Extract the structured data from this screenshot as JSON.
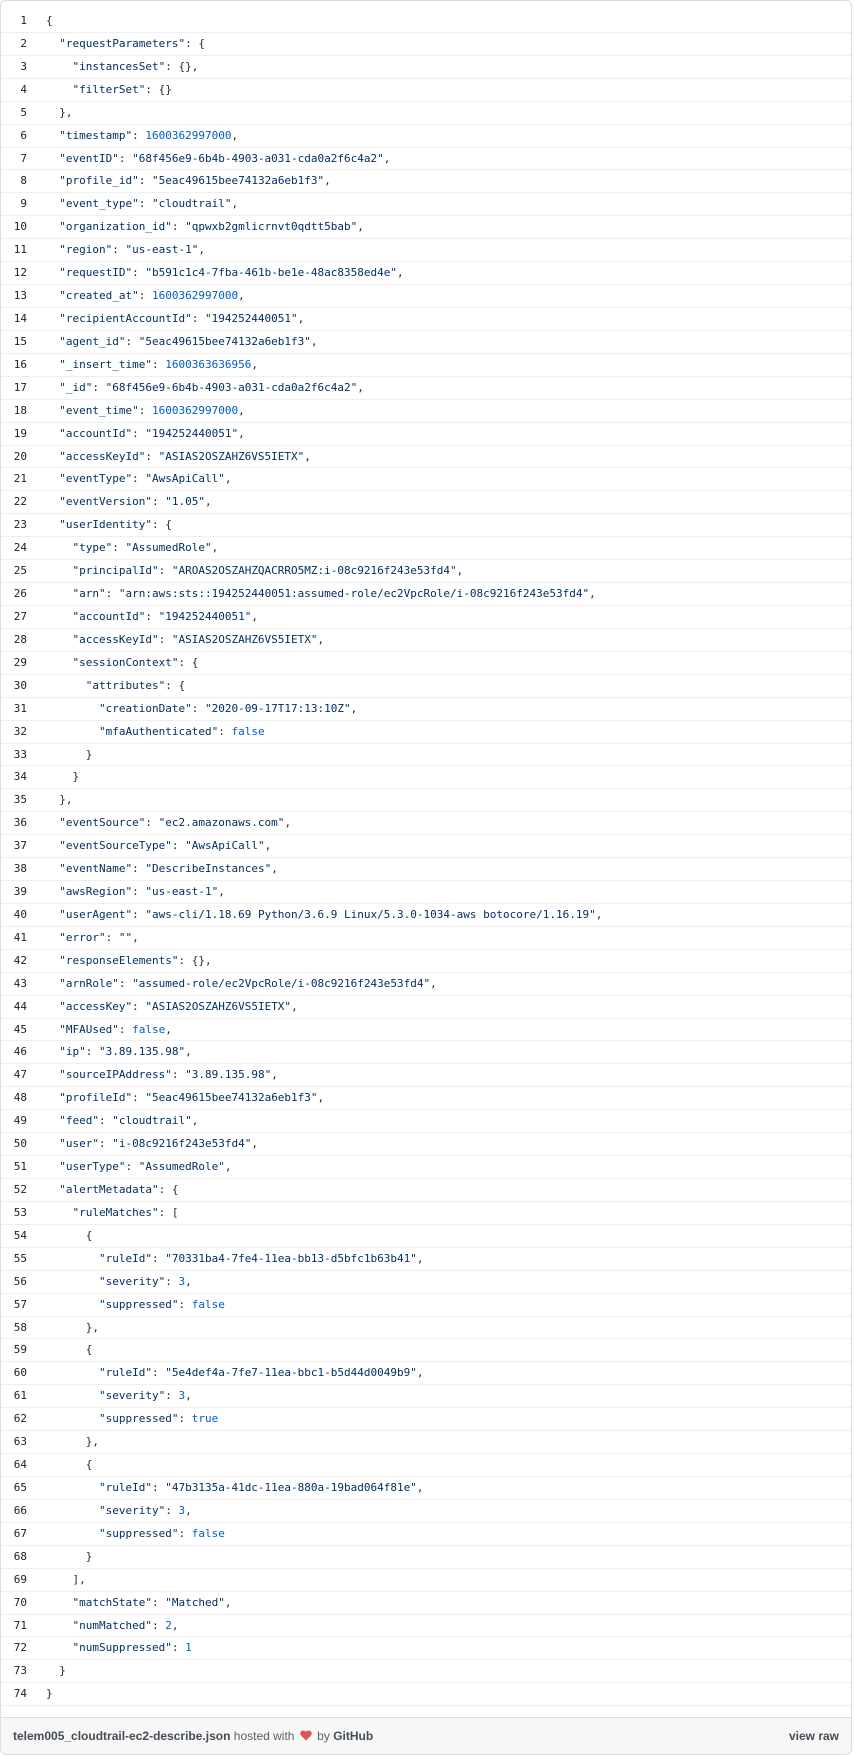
{
  "lines": [
    [
      {
        "t": "p",
        "v": "{"
      }
    ],
    [
      {
        "t": "p",
        "v": "  "
      },
      {
        "t": "k",
        "v": "\"requestParameters\""
      },
      {
        "t": "p",
        "v": ": {"
      }
    ],
    [
      {
        "t": "p",
        "v": "    "
      },
      {
        "t": "k",
        "v": "\"instancesSet\""
      },
      {
        "t": "p",
        "v": ": {},"
      }
    ],
    [
      {
        "t": "p",
        "v": "    "
      },
      {
        "t": "k",
        "v": "\"filterSet\""
      },
      {
        "t": "p",
        "v": ": {}"
      }
    ],
    [
      {
        "t": "p",
        "v": "  },"
      }
    ],
    [
      {
        "t": "p",
        "v": "  "
      },
      {
        "t": "k",
        "v": "\"timestamp\""
      },
      {
        "t": "p",
        "v": ": "
      },
      {
        "t": "n",
        "v": "1600362997000"
      },
      {
        "t": "p",
        "v": ","
      }
    ],
    [
      {
        "t": "p",
        "v": "  "
      },
      {
        "t": "k",
        "v": "\"eventID\""
      },
      {
        "t": "p",
        "v": ": "
      },
      {
        "t": "s",
        "v": "\"68f456e9-6b4b-4903-a031-cda0a2f6c4a2\""
      },
      {
        "t": "p",
        "v": ","
      }
    ],
    [
      {
        "t": "p",
        "v": "  "
      },
      {
        "t": "k",
        "v": "\"profile_id\""
      },
      {
        "t": "p",
        "v": ": "
      },
      {
        "t": "s",
        "v": "\"5eac49615bee74132a6eb1f3\""
      },
      {
        "t": "p",
        "v": ","
      }
    ],
    [
      {
        "t": "p",
        "v": "  "
      },
      {
        "t": "k",
        "v": "\"event_type\""
      },
      {
        "t": "p",
        "v": ": "
      },
      {
        "t": "s",
        "v": "\"cloudtrail\""
      },
      {
        "t": "p",
        "v": ","
      }
    ],
    [
      {
        "t": "p",
        "v": "  "
      },
      {
        "t": "k",
        "v": "\"organization_id\""
      },
      {
        "t": "p",
        "v": ": "
      },
      {
        "t": "s",
        "v": "\"qpwxb2gmlicrnvt0qdtt5bab\""
      },
      {
        "t": "p",
        "v": ","
      }
    ],
    [
      {
        "t": "p",
        "v": "  "
      },
      {
        "t": "k",
        "v": "\"region\""
      },
      {
        "t": "p",
        "v": ": "
      },
      {
        "t": "s",
        "v": "\"us-east-1\""
      },
      {
        "t": "p",
        "v": ","
      }
    ],
    [
      {
        "t": "p",
        "v": "  "
      },
      {
        "t": "k",
        "v": "\"requestID\""
      },
      {
        "t": "p",
        "v": ": "
      },
      {
        "t": "s",
        "v": "\"b591c1c4-7fba-461b-be1e-48ac8358ed4e\""
      },
      {
        "t": "p",
        "v": ","
      }
    ],
    [
      {
        "t": "p",
        "v": "  "
      },
      {
        "t": "k",
        "v": "\"created_at\""
      },
      {
        "t": "p",
        "v": ": "
      },
      {
        "t": "n",
        "v": "1600362997000"
      },
      {
        "t": "p",
        "v": ","
      }
    ],
    [
      {
        "t": "p",
        "v": "  "
      },
      {
        "t": "k",
        "v": "\"recipientAccountId\""
      },
      {
        "t": "p",
        "v": ": "
      },
      {
        "t": "s",
        "v": "\"194252440051\""
      },
      {
        "t": "p",
        "v": ","
      }
    ],
    [
      {
        "t": "p",
        "v": "  "
      },
      {
        "t": "k",
        "v": "\"agent_id\""
      },
      {
        "t": "p",
        "v": ": "
      },
      {
        "t": "s",
        "v": "\"5eac49615bee74132a6eb1f3\""
      },
      {
        "t": "p",
        "v": ","
      }
    ],
    [
      {
        "t": "p",
        "v": "  "
      },
      {
        "t": "k",
        "v": "\"_insert_time\""
      },
      {
        "t": "p",
        "v": ": "
      },
      {
        "t": "n",
        "v": "1600363636956"
      },
      {
        "t": "p",
        "v": ","
      }
    ],
    [
      {
        "t": "p",
        "v": "  "
      },
      {
        "t": "k",
        "v": "\"_id\""
      },
      {
        "t": "p",
        "v": ": "
      },
      {
        "t": "s",
        "v": "\"68f456e9-6b4b-4903-a031-cda0a2f6c4a2\""
      },
      {
        "t": "p",
        "v": ","
      }
    ],
    [
      {
        "t": "p",
        "v": "  "
      },
      {
        "t": "k",
        "v": "\"event_time\""
      },
      {
        "t": "p",
        "v": ": "
      },
      {
        "t": "n",
        "v": "1600362997000"
      },
      {
        "t": "p",
        "v": ","
      }
    ],
    [
      {
        "t": "p",
        "v": "  "
      },
      {
        "t": "k",
        "v": "\"accountId\""
      },
      {
        "t": "p",
        "v": ": "
      },
      {
        "t": "s",
        "v": "\"194252440051\""
      },
      {
        "t": "p",
        "v": ","
      }
    ],
    [
      {
        "t": "p",
        "v": "  "
      },
      {
        "t": "k",
        "v": "\"accessKeyId\""
      },
      {
        "t": "p",
        "v": ": "
      },
      {
        "t": "s",
        "v": "\"ASIAS2OSZAHZ6VS5IETX\""
      },
      {
        "t": "p",
        "v": ","
      }
    ],
    [
      {
        "t": "p",
        "v": "  "
      },
      {
        "t": "k",
        "v": "\"eventType\""
      },
      {
        "t": "p",
        "v": ": "
      },
      {
        "t": "s",
        "v": "\"AwsApiCall\""
      },
      {
        "t": "p",
        "v": ","
      }
    ],
    [
      {
        "t": "p",
        "v": "  "
      },
      {
        "t": "k",
        "v": "\"eventVersion\""
      },
      {
        "t": "p",
        "v": ": "
      },
      {
        "t": "s",
        "v": "\"1.05\""
      },
      {
        "t": "p",
        "v": ","
      }
    ],
    [
      {
        "t": "p",
        "v": "  "
      },
      {
        "t": "k",
        "v": "\"userIdentity\""
      },
      {
        "t": "p",
        "v": ": {"
      }
    ],
    [
      {
        "t": "p",
        "v": "    "
      },
      {
        "t": "k",
        "v": "\"type\""
      },
      {
        "t": "p",
        "v": ": "
      },
      {
        "t": "s",
        "v": "\"AssumedRole\""
      },
      {
        "t": "p",
        "v": ","
      }
    ],
    [
      {
        "t": "p",
        "v": "    "
      },
      {
        "t": "k",
        "v": "\"principalId\""
      },
      {
        "t": "p",
        "v": ": "
      },
      {
        "t": "s",
        "v": "\"AROAS2OSZAHZQACRRO5MZ:i-08c9216f243e53fd4\""
      },
      {
        "t": "p",
        "v": ","
      }
    ],
    [
      {
        "t": "p",
        "v": "    "
      },
      {
        "t": "k",
        "v": "\"arn\""
      },
      {
        "t": "p",
        "v": ": "
      },
      {
        "t": "s",
        "v": "\"arn:aws:sts::194252440051:assumed-role/ec2VpcRole/i-08c9216f243e53fd4\""
      },
      {
        "t": "p",
        "v": ","
      }
    ],
    [
      {
        "t": "p",
        "v": "    "
      },
      {
        "t": "k",
        "v": "\"accountId\""
      },
      {
        "t": "p",
        "v": ": "
      },
      {
        "t": "s",
        "v": "\"194252440051\""
      },
      {
        "t": "p",
        "v": ","
      }
    ],
    [
      {
        "t": "p",
        "v": "    "
      },
      {
        "t": "k",
        "v": "\"accessKeyId\""
      },
      {
        "t": "p",
        "v": ": "
      },
      {
        "t": "s",
        "v": "\"ASIAS2OSZAHZ6VS5IETX\""
      },
      {
        "t": "p",
        "v": ","
      }
    ],
    [
      {
        "t": "p",
        "v": "    "
      },
      {
        "t": "k",
        "v": "\"sessionContext\""
      },
      {
        "t": "p",
        "v": ": {"
      }
    ],
    [
      {
        "t": "p",
        "v": "      "
      },
      {
        "t": "k",
        "v": "\"attributes\""
      },
      {
        "t": "p",
        "v": ": {"
      }
    ],
    [
      {
        "t": "p",
        "v": "        "
      },
      {
        "t": "k",
        "v": "\"creationDate\""
      },
      {
        "t": "p",
        "v": ": "
      },
      {
        "t": "s",
        "v": "\"2020-09-17T17:13:10Z\""
      },
      {
        "t": "p",
        "v": ","
      }
    ],
    [
      {
        "t": "p",
        "v": "        "
      },
      {
        "t": "k",
        "v": "\"mfaAuthenticated\""
      },
      {
        "t": "p",
        "v": ": "
      },
      {
        "t": "n",
        "v": "false"
      }
    ],
    [
      {
        "t": "p",
        "v": "      }"
      }
    ],
    [
      {
        "t": "p",
        "v": "    }"
      }
    ],
    [
      {
        "t": "p",
        "v": "  },"
      }
    ],
    [
      {
        "t": "p",
        "v": "  "
      },
      {
        "t": "k",
        "v": "\"eventSource\""
      },
      {
        "t": "p",
        "v": ": "
      },
      {
        "t": "s",
        "v": "\"ec2.amazonaws.com\""
      },
      {
        "t": "p",
        "v": ","
      }
    ],
    [
      {
        "t": "p",
        "v": "  "
      },
      {
        "t": "k",
        "v": "\"eventSourceType\""
      },
      {
        "t": "p",
        "v": ": "
      },
      {
        "t": "s",
        "v": "\"AwsApiCall\""
      },
      {
        "t": "p",
        "v": ","
      }
    ],
    [
      {
        "t": "p",
        "v": "  "
      },
      {
        "t": "k",
        "v": "\"eventName\""
      },
      {
        "t": "p",
        "v": ": "
      },
      {
        "t": "s",
        "v": "\"DescribeInstances\""
      },
      {
        "t": "p",
        "v": ","
      }
    ],
    [
      {
        "t": "p",
        "v": "  "
      },
      {
        "t": "k",
        "v": "\"awsRegion\""
      },
      {
        "t": "p",
        "v": ": "
      },
      {
        "t": "s",
        "v": "\"us-east-1\""
      },
      {
        "t": "p",
        "v": ","
      }
    ],
    [
      {
        "t": "p",
        "v": "  "
      },
      {
        "t": "k",
        "v": "\"userAgent\""
      },
      {
        "t": "p",
        "v": ": "
      },
      {
        "t": "s",
        "v": "\"aws-cli/1.18.69 Python/3.6.9 Linux/5.3.0-1034-aws botocore/1.16.19\""
      },
      {
        "t": "p",
        "v": ","
      }
    ],
    [
      {
        "t": "p",
        "v": "  "
      },
      {
        "t": "k",
        "v": "\"error\""
      },
      {
        "t": "p",
        "v": ": "
      },
      {
        "t": "s",
        "v": "\"\""
      },
      {
        "t": "p",
        "v": ","
      }
    ],
    [
      {
        "t": "p",
        "v": "  "
      },
      {
        "t": "k",
        "v": "\"responseElements\""
      },
      {
        "t": "p",
        "v": ": {},"
      }
    ],
    [
      {
        "t": "p",
        "v": "  "
      },
      {
        "t": "k",
        "v": "\"arnRole\""
      },
      {
        "t": "p",
        "v": ": "
      },
      {
        "t": "s",
        "v": "\"assumed-role/ec2VpcRole/i-08c9216f243e53fd4\""
      },
      {
        "t": "p",
        "v": ","
      }
    ],
    [
      {
        "t": "p",
        "v": "  "
      },
      {
        "t": "k",
        "v": "\"accessKey\""
      },
      {
        "t": "p",
        "v": ": "
      },
      {
        "t": "s",
        "v": "\"ASIAS2OSZAHZ6VS5IETX\""
      },
      {
        "t": "p",
        "v": ","
      }
    ],
    [
      {
        "t": "p",
        "v": "  "
      },
      {
        "t": "k",
        "v": "\"MFAUsed\""
      },
      {
        "t": "p",
        "v": ": "
      },
      {
        "t": "n",
        "v": "false"
      },
      {
        "t": "p",
        "v": ","
      }
    ],
    [
      {
        "t": "p",
        "v": "  "
      },
      {
        "t": "k",
        "v": "\"ip\""
      },
      {
        "t": "p",
        "v": ": "
      },
      {
        "t": "s",
        "v": "\"3.89.135.98\""
      },
      {
        "t": "p",
        "v": ","
      }
    ],
    [
      {
        "t": "p",
        "v": "  "
      },
      {
        "t": "k",
        "v": "\"sourceIPAddress\""
      },
      {
        "t": "p",
        "v": ": "
      },
      {
        "t": "s",
        "v": "\"3.89.135.98\""
      },
      {
        "t": "p",
        "v": ","
      }
    ],
    [
      {
        "t": "p",
        "v": "  "
      },
      {
        "t": "k",
        "v": "\"profileId\""
      },
      {
        "t": "p",
        "v": ": "
      },
      {
        "t": "s",
        "v": "\"5eac49615bee74132a6eb1f3\""
      },
      {
        "t": "p",
        "v": ","
      }
    ],
    [
      {
        "t": "p",
        "v": "  "
      },
      {
        "t": "k",
        "v": "\"feed\""
      },
      {
        "t": "p",
        "v": ": "
      },
      {
        "t": "s",
        "v": "\"cloudtrail\""
      },
      {
        "t": "p",
        "v": ","
      }
    ],
    [
      {
        "t": "p",
        "v": "  "
      },
      {
        "t": "k",
        "v": "\"user\""
      },
      {
        "t": "p",
        "v": ": "
      },
      {
        "t": "s",
        "v": "\"i-08c9216f243e53fd4\""
      },
      {
        "t": "p",
        "v": ","
      }
    ],
    [
      {
        "t": "p",
        "v": "  "
      },
      {
        "t": "k",
        "v": "\"userType\""
      },
      {
        "t": "p",
        "v": ": "
      },
      {
        "t": "s",
        "v": "\"AssumedRole\""
      },
      {
        "t": "p",
        "v": ","
      }
    ],
    [
      {
        "t": "p",
        "v": "  "
      },
      {
        "t": "k",
        "v": "\"alertMetadata\""
      },
      {
        "t": "p",
        "v": ": {"
      }
    ],
    [
      {
        "t": "p",
        "v": "    "
      },
      {
        "t": "k",
        "v": "\"ruleMatches\""
      },
      {
        "t": "p",
        "v": ": ["
      }
    ],
    [
      {
        "t": "p",
        "v": "      {"
      }
    ],
    [
      {
        "t": "p",
        "v": "        "
      },
      {
        "t": "k",
        "v": "\"ruleId\""
      },
      {
        "t": "p",
        "v": ": "
      },
      {
        "t": "s",
        "v": "\"70331ba4-7fe4-11ea-bb13-d5bfc1b63b41\""
      },
      {
        "t": "p",
        "v": ","
      }
    ],
    [
      {
        "t": "p",
        "v": "        "
      },
      {
        "t": "k",
        "v": "\"severity\""
      },
      {
        "t": "p",
        "v": ": "
      },
      {
        "t": "n",
        "v": "3"
      },
      {
        "t": "p",
        "v": ","
      }
    ],
    [
      {
        "t": "p",
        "v": "        "
      },
      {
        "t": "k",
        "v": "\"suppressed\""
      },
      {
        "t": "p",
        "v": ": "
      },
      {
        "t": "n",
        "v": "false"
      }
    ],
    [
      {
        "t": "p",
        "v": "      },"
      }
    ],
    [
      {
        "t": "p",
        "v": "      {"
      }
    ],
    [
      {
        "t": "p",
        "v": "        "
      },
      {
        "t": "k",
        "v": "\"ruleId\""
      },
      {
        "t": "p",
        "v": ": "
      },
      {
        "t": "s",
        "v": "\"5e4def4a-7fe7-11ea-bbc1-b5d44d0049b9\""
      },
      {
        "t": "p",
        "v": ","
      }
    ],
    [
      {
        "t": "p",
        "v": "        "
      },
      {
        "t": "k",
        "v": "\"severity\""
      },
      {
        "t": "p",
        "v": ": "
      },
      {
        "t": "n",
        "v": "3"
      },
      {
        "t": "p",
        "v": ","
      }
    ],
    [
      {
        "t": "p",
        "v": "        "
      },
      {
        "t": "k",
        "v": "\"suppressed\""
      },
      {
        "t": "p",
        "v": ": "
      },
      {
        "t": "n",
        "v": "true"
      }
    ],
    [
      {
        "t": "p",
        "v": "      },"
      }
    ],
    [
      {
        "t": "p",
        "v": "      {"
      }
    ],
    [
      {
        "t": "p",
        "v": "        "
      },
      {
        "t": "k",
        "v": "\"ruleId\""
      },
      {
        "t": "p",
        "v": ": "
      },
      {
        "t": "s",
        "v": "\"47b3135a-41dc-11ea-880a-19bad064f81e\""
      },
      {
        "t": "p",
        "v": ","
      }
    ],
    [
      {
        "t": "p",
        "v": "        "
      },
      {
        "t": "k",
        "v": "\"severity\""
      },
      {
        "t": "p",
        "v": ": "
      },
      {
        "t": "n",
        "v": "3"
      },
      {
        "t": "p",
        "v": ","
      }
    ],
    [
      {
        "t": "p",
        "v": "        "
      },
      {
        "t": "k",
        "v": "\"suppressed\""
      },
      {
        "t": "p",
        "v": ": "
      },
      {
        "t": "n",
        "v": "false"
      }
    ],
    [
      {
        "t": "p",
        "v": "      }"
      }
    ],
    [
      {
        "t": "p",
        "v": "    ],"
      }
    ],
    [
      {
        "t": "p",
        "v": "    "
      },
      {
        "t": "k",
        "v": "\"matchState\""
      },
      {
        "t": "p",
        "v": ": "
      },
      {
        "t": "s",
        "v": "\"Matched\""
      },
      {
        "t": "p",
        "v": ","
      }
    ],
    [
      {
        "t": "p",
        "v": "    "
      },
      {
        "t": "k",
        "v": "\"numMatched\""
      },
      {
        "t": "p",
        "v": ": "
      },
      {
        "t": "n",
        "v": "2"
      },
      {
        "t": "p",
        "v": ","
      }
    ],
    [
      {
        "t": "p",
        "v": "    "
      },
      {
        "t": "k",
        "v": "\"numSuppressed\""
      },
      {
        "t": "p",
        "v": ": "
      },
      {
        "t": "n",
        "v": "1"
      }
    ],
    [
      {
        "t": "p",
        "v": "  }"
      }
    ],
    [
      {
        "t": "p",
        "v": "}"
      }
    ]
  ],
  "footer": {
    "file_name": "telem005_cloudtrail-ec2-describe.json",
    "hosted_with": "hosted with",
    "by": "by",
    "host_name": "GitHub",
    "view_raw": "view raw",
    "heart_icon": "heart-icon",
    "heart_color": "#e25555"
  },
  "colors": {
    "key": "#032f62",
    "string": "#032f62",
    "number": "#005cc5"
  }
}
